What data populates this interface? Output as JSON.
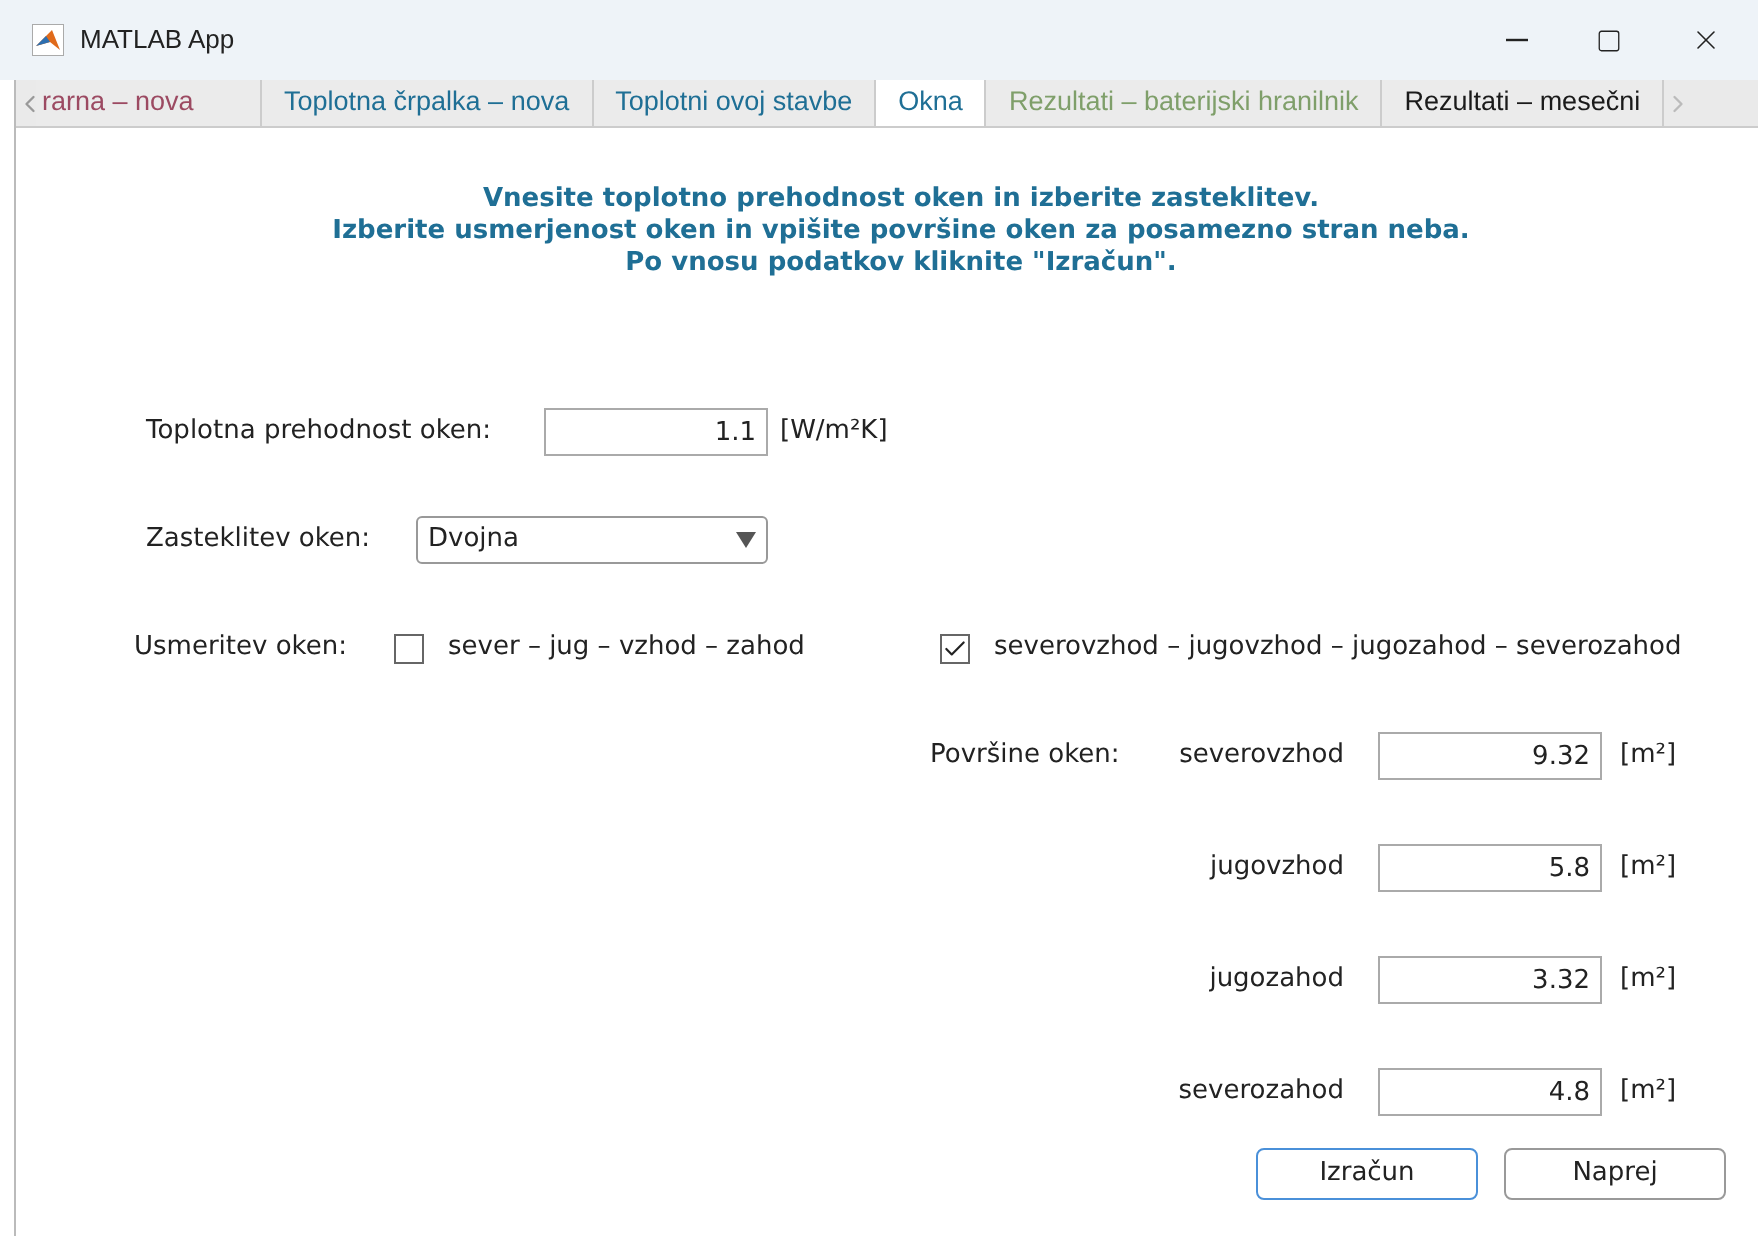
{
  "window": {
    "title": "MATLAB App"
  },
  "tabs": [
    {
      "label": "rarna – nova",
      "selected": false,
      "color": "#9c4a62"
    },
    {
      "label": "Toplotna črpalka – nova",
      "selected": false,
      "color": "#1f6f95"
    },
    {
      "label": "Toplotni ovoj stavbe",
      "selected": false,
      "color": "#1f6f95"
    },
    {
      "label": "Okna",
      "selected": true,
      "color": "#1f6f95"
    },
    {
      "label": "Rezultati – baterijski hranilnik",
      "selected": false,
      "color": "#7f9f6a"
    },
    {
      "label": "Rezultati – mesečni",
      "selected": false,
      "color": "#1a1a1a"
    }
  ],
  "instructions": [
    "Vnesite toplotno prehodnost oken in izberite zasteklitev.",
    "Izberite usmerjenost oken in vpišite površine oken za posamezno stran neba.",
    "Po vnosu podatkov kliknite \"Izračun\"."
  ],
  "transmittance": {
    "label": "Toplotna prehodnost oken:",
    "value": "1.1",
    "unit": "[W/m²K]"
  },
  "glazing": {
    "label": "Zasteklitev oken:",
    "value": "Dvojna"
  },
  "orientation": {
    "label": "Usmeritev oken:",
    "options": [
      {
        "label": "sever – jug – vzhod – zahod",
        "checked": false
      },
      {
        "label": "severovzhod – jugovzhod – jugozahod – severozahod",
        "checked": true
      }
    ]
  },
  "areas": {
    "label": "Površine oken:",
    "rows": [
      {
        "direction": "severovzhod",
        "value": "9.32",
        "unit": "[m²]"
      },
      {
        "direction": "jugovzhod",
        "value": "5.8",
        "unit": "[m²]"
      },
      {
        "direction": "jugozahod",
        "value": "3.32",
        "unit": "[m²]"
      },
      {
        "direction": "severozahod",
        "value": "4.8",
        "unit": "[m²]"
      }
    ]
  },
  "buttons": [
    "Izračun",
    "Naprej"
  ]
}
